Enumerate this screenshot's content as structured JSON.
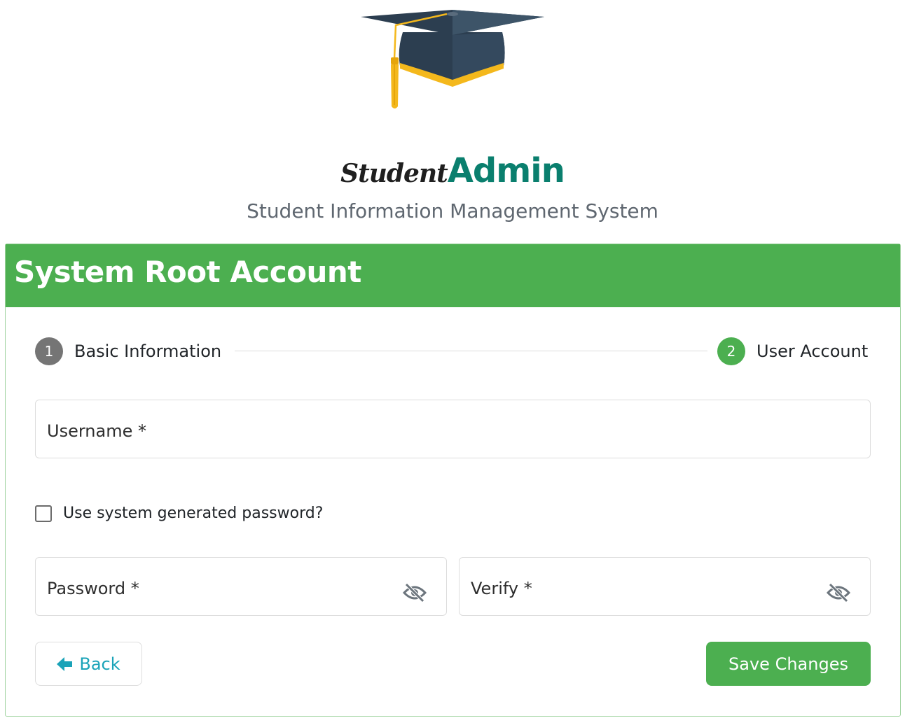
{
  "brand": {
    "part1": "Student",
    "part2": "Admin",
    "subtitle": "Student Information Management System",
    "logo_icon": "graduation-cap-icon"
  },
  "card": {
    "title": "System Root Account",
    "header_color": "#4caf50"
  },
  "stepper": {
    "steps": [
      {
        "number": "1",
        "label": "Basic Information",
        "state": "completed"
      },
      {
        "number": "2",
        "label": "User Account",
        "state": "active"
      }
    ]
  },
  "form": {
    "username": {
      "label": "Username *",
      "value": ""
    },
    "use_generated_password": {
      "label": "Use system generated password?",
      "checked": false
    },
    "password": {
      "label": "Password *",
      "value": "",
      "icon": "eye-slash-icon"
    },
    "verify": {
      "label": "Verify *",
      "value": "",
      "icon": "eye-slash-icon"
    }
  },
  "buttons": {
    "back": {
      "label": "Back",
      "icon": "arrow-left-icon"
    },
    "save": {
      "label": "Save Changes"
    }
  },
  "colors": {
    "accent": "#4caf50",
    "brand_teal": "#0a7f6e",
    "link": "#1aa3b8",
    "step_inactive": "#757575"
  }
}
